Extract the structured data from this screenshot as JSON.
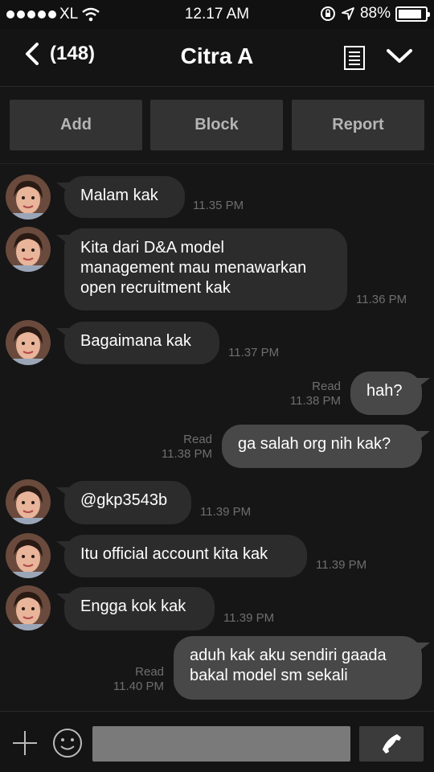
{
  "status_bar": {
    "carrier": "XL",
    "time": "12.17 AM",
    "battery": "88%",
    "battery_level": 0.88
  },
  "header": {
    "back_count": "(148)",
    "title": "Citra A",
    "icons": [
      "chevron-left-icon",
      "note-icon",
      "chevron-down-icon"
    ]
  },
  "actions": {
    "add": "Add",
    "block": "Block",
    "report": "Report"
  },
  "messages": [
    {
      "dir": "in",
      "lines": [
        "Malam kak"
      ],
      "time": "11.35 PM"
    },
    {
      "dir": "in",
      "lines": [
        "Kita dari D&A model",
        "management mau menawarkan",
        "open recruitment kak"
      ],
      "time": "11.36 PM"
    },
    {
      "dir": "in",
      "lines": [
        "Bagaimana kak"
      ],
      "time": "11.37 PM"
    },
    {
      "dir": "out",
      "lines": [
        "hah?"
      ],
      "read": "Read",
      "time": "11.38 PM"
    },
    {
      "dir": "out",
      "lines": [
        "ga salah org nih kak?"
      ],
      "read": "Read",
      "time": "11.38 PM"
    },
    {
      "dir": "in",
      "lines": [
        "@gkp3543b"
      ],
      "time": "11.39 PM"
    },
    {
      "dir": "in",
      "lines": [
        "Itu official account kita kak"
      ],
      "time": "11.39 PM"
    },
    {
      "dir": "in",
      "lines": [
        "Engga kok kak"
      ],
      "time": "11.39 PM"
    },
    {
      "dir": "out",
      "lines": [
        "aduh kak aku sendiri gaada",
        "bakal model sm sekali"
      ],
      "read": "Read",
      "time": "11.40 PM"
    }
  ],
  "composer": {
    "placeholder": ""
  },
  "colors": {
    "background": "#161616",
    "bubble_in": "#2c2c2c",
    "bubble_out": "#484848",
    "timestamp": "#6e6e6e"
  }
}
